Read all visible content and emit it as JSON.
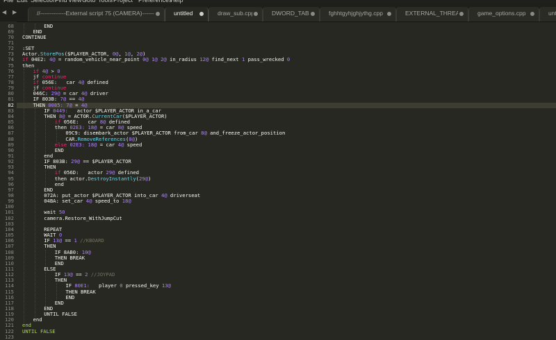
{
  "menu": [
    "File",
    "Edit",
    "Selection",
    "Find",
    "View",
    "Goto",
    "Tools",
    "Project",
    "Preferences",
    "Help"
  ],
  "tabs": [
    {
      "label": "//-------------External script 75 (CAMERA)---------",
      "dirty": true,
      "active": false
    },
    {
      "label": "untitled",
      "dirty": true,
      "active": true
    },
    {
      "label": "draw_sub.cpp",
      "dirty": true,
      "active": false
    },
    {
      "label": "DWORD_TABLE.cpp",
      "dirty": true,
      "active": false
    },
    {
      "label": "fghhtgyhjghjythg.cpp",
      "dirty": true,
      "active": false
    },
    {
      "label": "EXTERNAL_THREAD.CPP",
      "dirty": true,
      "active": false
    },
    {
      "label": "game_options.cpp",
      "dirty": true,
      "active": false
    },
    {
      "label": "untit",
      "dirty": false,
      "active": false
    }
  ],
  "nav_arrows": {
    "left": "◀",
    "right": "▶"
  },
  "colors": {
    "background": "#272822",
    "text": "#f8f8f2",
    "keyword": "#f92672",
    "number": "#ae81ff",
    "function": "#66d9ef",
    "green": "#a6e22e",
    "comment": "#75715e",
    "current_line": "#3e3d32"
  },
  "editor": {
    "current_line": 82,
    "lines": [
      {
        "n": 68,
        "i": 2,
        "t": [
          [
            "p",
            "END"
          ]
        ]
      },
      {
        "n": 69,
        "i": 1,
        "t": [
          [
            "p",
            "END"
          ]
        ]
      },
      {
        "n": 70,
        "i": 0,
        "t": [
          [
            "p",
            "CONTINUE"
          ]
        ]
      },
      {
        "n": 71,
        "i": 0,
        "t": []
      },
      {
        "n": 72,
        "i": 0,
        "t": [
          [
            "p",
            ":SET"
          ]
        ]
      },
      {
        "n": 73,
        "i": 0,
        "t": [
          [
            "p",
            "Actor."
          ],
          [
            "f",
            "StorePos"
          ],
          [
            "p",
            "($PLAYER_ACTOR, "
          ],
          [
            "n",
            "0@"
          ],
          [
            "p",
            ", "
          ],
          [
            "n",
            "1@"
          ],
          [
            "p",
            ", "
          ],
          [
            "n",
            "2@"
          ],
          [
            "p",
            ")"
          ]
        ]
      },
      {
        "n": 74,
        "i": 0,
        "t": [
          [
            "k",
            "if"
          ],
          [
            "p",
            " 04E2: "
          ],
          [
            "n",
            "4@"
          ],
          [
            "p",
            " = random_vehicle_near_point "
          ],
          [
            "n",
            "0@ 1@ 2@"
          ],
          [
            "p",
            " in_radius "
          ],
          [
            "n",
            "12@"
          ],
          [
            "p",
            " find_next "
          ],
          [
            "n",
            "1"
          ],
          [
            "p",
            " pass_wrecked "
          ],
          [
            "n",
            "0"
          ]
        ]
      },
      {
        "n": 75,
        "i": 0,
        "t": [
          [
            "p",
            "then"
          ]
        ]
      },
      {
        "n": 76,
        "i": 1,
        "t": [
          [
            "k",
            "if"
          ],
          [
            "p",
            " "
          ],
          [
            "n",
            "4@"
          ],
          [
            "p",
            " > "
          ],
          [
            "n",
            "0"
          ]
        ]
      },
      {
        "n": 77,
        "i": 1,
        "t": [
          [
            "p",
            "jf "
          ],
          [
            "k",
            "continue"
          ]
        ]
      },
      {
        "n": 78,
        "i": 1,
        "t": [
          [
            "k",
            "if"
          ],
          [
            "p",
            " 056E:   car "
          ],
          [
            "n",
            "4@"
          ],
          [
            "p",
            " defined"
          ]
        ]
      },
      {
        "n": 79,
        "i": 1,
        "t": [
          [
            "p",
            "jf "
          ],
          [
            "k",
            "continue"
          ]
        ]
      },
      {
        "n": 80,
        "i": 1,
        "t": [
          [
            "p",
            "046C: "
          ],
          [
            "n",
            "29@"
          ],
          [
            "p",
            " = car "
          ],
          [
            "n",
            "4@"
          ],
          [
            "p",
            " driver"
          ]
        ]
      },
      {
        "n": 81,
        "i": 1,
        "t": [
          [
            "p",
            "IF 803B: "
          ],
          [
            "n",
            "7@"
          ],
          [
            "p",
            " == "
          ],
          [
            "n",
            "4@"
          ]
        ]
      },
      {
        "n": 82,
        "i": 1,
        "t": [
          [
            "p",
            "THEN "
          ],
          [
            "n",
            "0085:"
          ],
          [
            "p",
            " "
          ],
          [
            "n",
            "7@"
          ],
          [
            "p",
            " = "
          ],
          [
            "n",
            "4@"
          ]
        ]
      },
      {
        "n": 83,
        "i": 2,
        "t": [
          [
            "p",
            "IF "
          ],
          [
            "n",
            "0449:"
          ],
          [
            "p",
            "   actor $PLAYER_ACTOR in_a_car"
          ]
        ]
      },
      {
        "n": 84,
        "i": 2,
        "t": [
          [
            "p",
            "THEN "
          ],
          [
            "n",
            "8@"
          ],
          [
            "p",
            " = ACTOR."
          ],
          [
            "f",
            "CurrentCar"
          ],
          [
            "p",
            "($PLAYER_ACTOR)"
          ]
        ]
      },
      {
        "n": 85,
        "i": 3,
        "t": [
          [
            "k",
            "if"
          ],
          [
            "p",
            " 056E:   car "
          ],
          [
            "n",
            "8@"
          ],
          [
            "p",
            " defined"
          ]
        ]
      },
      {
        "n": 86,
        "i": 3,
        "t": [
          [
            "p",
            "then "
          ],
          [
            "n",
            "02E3:"
          ],
          [
            "p",
            " "
          ],
          [
            "n",
            "18@"
          ],
          [
            "p",
            " = car "
          ],
          [
            "n",
            "8@"
          ],
          [
            "p",
            " speed"
          ]
        ]
      },
      {
        "n": 87,
        "i": 4,
        "t": [
          [
            "p",
            "09C9: disembark_actor $PLAYER_ACTOR from_car "
          ],
          [
            "n",
            "8@"
          ],
          [
            "p",
            " and_freeze_actor_position"
          ]
        ]
      },
      {
        "n": 88,
        "i": 4,
        "t": [
          [
            "p",
            "CAR."
          ],
          [
            "f",
            "RemoveReferences"
          ],
          [
            "p",
            "("
          ],
          [
            "n",
            "8@"
          ],
          [
            "p",
            ")"
          ]
        ]
      },
      {
        "n": 89,
        "i": 3,
        "t": [
          [
            "k",
            "else"
          ],
          [
            "p",
            " "
          ],
          [
            "n",
            "02E3:"
          ],
          [
            "p",
            " "
          ],
          [
            "n",
            "18@"
          ],
          [
            "p",
            " = car "
          ],
          [
            "n",
            "4@"
          ],
          [
            "p",
            " speed"
          ]
        ]
      },
      {
        "n": 90,
        "i": 3,
        "t": [
          [
            "p",
            "END"
          ]
        ]
      },
      {
        "n": 91,
        "i": 2,
        "t": [
          [
            "p",
            "end"
          ]
        ]
      },
      {
        "n": 92,
        "i": 2,
        "t": [
          [
            "p",
            "IF 803B: "
          ],
          [
            "n",
            "29@"
          ],
          [
            "p",
            " == $PLAYER_ACTOR"
          ]
        ]
      },
      {
        "n": 93,
        "i": 2,
        "t": [
          [
            "p",
            "THEN"
          ]
        ]
      },
      {
        "n": 94,
        "i": 3,
        "t": [
          [
            "k",
            "if"
          ],
          [
            "p",
            " 056D:   actor "
          ],
          [
            "n",
            "29@"
          ],
          [
            "p",
            " defined"
          ]
        ]
      },
      {
        "n": 95,
        "i": 3,
        "t": [
          [
            "p",
            "then actor."
          ],
          [
            "f",
            "DestroyInstantly"
          ],
          [
            "p",
            "("
          ],
          [
            "n",
            "29@"
          ],
          [
            "p",
            ")"
          ]
        ]
      },
      {
        "n": 96,
        "i": 3,
        "t": [
          [
            "p",
            "end"
          ]
        ]
      },
      {
        "n": 97,
        "i": 2,
        "t": [
          [
            "p",
            "END"
          ]
        ]
      },
      {
        "n": 98,
        "i": 2,
        "t": [
          [
            "p",
            "072A: put_actor $PLAYER_ACTOR into_car "
          ],
          [
            "n",
            "4@"
          ],
          [
            "p",
            " driverseat"
          ]
        ]
      },
      {
        "n": 99,
        "i": 2,
        "t": [
          [
            "p",
            "04BA: set_car "
          ],
          [
            "n",
            "4@"
          ],
          [
            "p",
            " speed_to "
          ],
          [
            "n",
            "18@"
          ]
        ]
      },
      {
        "n": 100,
        "i": 2,
        "t": []
      },
      {
        "n": 101,
        "i": 2,
        "t": [
          [
            "p",
            "wait "
          ],
          [
            "n",
            "50"
          ]
        ]
      },
      {
        "n": 102,
        "i": 2,
        "t": [
          [
            "p",
            "camera.Restore_WithJumpCut"
          ]
        ]
      },
      {
        "n": 103,
        "i": 2,
        "t": []
      },
      {
        "n": 104,
        "i": 2,
        "t": [
          [
            "p",
            "REPEAT"
          ]
        ]
      },
      {
        "n": 105,
        "i": 2,
        "t": [
          [
            "p",
            "WAIT "
          ],
          [
            "n",
            "0"
          ]
        ]
      },
      {
        "n": 106,
        "i": 2,
        "t": [
          [
            "p",
            "IF "
          ],
          [
            "n",
            "13@"
          ],
          [
            "p",
            " == "
          ],
          [
            "n",
            "1"
          ],
          [
            "p",
            " "
          ],
          [
            "c",
            "//KBOARD"
          ]
        ]
      },
      {
        "n": 107,
        "i": 2,
        "t": [
          [
            "p",
            "THEN"
          ]
        ]
      },
      {
        "n": 108,
        "i": 3,
        "t": [
          [
            "p",
            "IF 8AB0: "
          ],
          [
            "n",
            "10@"
          ]
        ]
      },
      {
        "n": 109,
        "i": 3,
        "t": [
          [
            "p",
            "THEN BREAK"
          ]
        ]
      },
      {
        "n": 110,
        "i": 3,
        "t": [
          [
            "p",
            "END"
          ]
        ]
      },
      {
        "n": 111,
        "i": 2,
        "t": [
          [
            "p",
            "ELSE"
          ]
        ]
      },
      {
        "n": 112,
        "i": 3,
        "t": [
          [
            "p",
            "IF "
          ],
          [
            "n",
            "13@"
          ],
          [
            "p",
            " == "
          ],
          [
            "n",
            "2"
          ],
          [
            "p",
            " "
          ],
          [
            "c",
            "//JOYPAD"
          ]
        ]
      },
      {
        "n": 113,
        "i": 3,
        "t": [
          [
            "p",
            "THEN"
          ]
        ]
      },
      {
        "n": 114,
        "i": 4,
        "t": [
          [
            "p",
            "IF "
          ],
          [
            "n",
            "80E1:"
          ],
          [
            "p",
            "   player "
          ],
          [
            "n",
            "0"
          ],
          [
            "p",
            " pressed_key "
          ],
          [
            "n",
            "13@"
          ]
        ]
      },
      {
        "n": 115,
        "i": 4,
        "t": [
          [
            "p",
            "THEN BREAK"
          ]
        ]
      },
      {
        "n": 116,
        "i": 4,
        "t": [
          [
            "p",
            "END"
          ]
        ]
      },
      {
        "n": 117,
        "i": 3,
        "t": [
          [
            "p",
            "END"
          ]
        ]
      },
      {
        "n": 118,
        "i": 2,
        "t": [
          [
            "p",
            "END"
          ]
        ]
      },
      {
        "n": 119,
        "i": 2,
        "t": [
          [
            "p",
            "UNTIL FALSE"
          ]
        ]
      },
      {
        "n": 120,
        "i": 1,
        "t": [
          [
            "p",
            "end"
          ]
        ]
      },
      {
        "n": 121,
        "i": 0,
        "t": [
          [
            "g",
            "end"
          ]
        ]
      },
      {
        "n": 122,
        "i": 0,
        "t": [
          [
            "g",
            "UNTIL FALSE"
          ]
        ]
      },
      {
        "n": 123,
        "i": 0,
        "t": []
      }
    ]
  }
}
